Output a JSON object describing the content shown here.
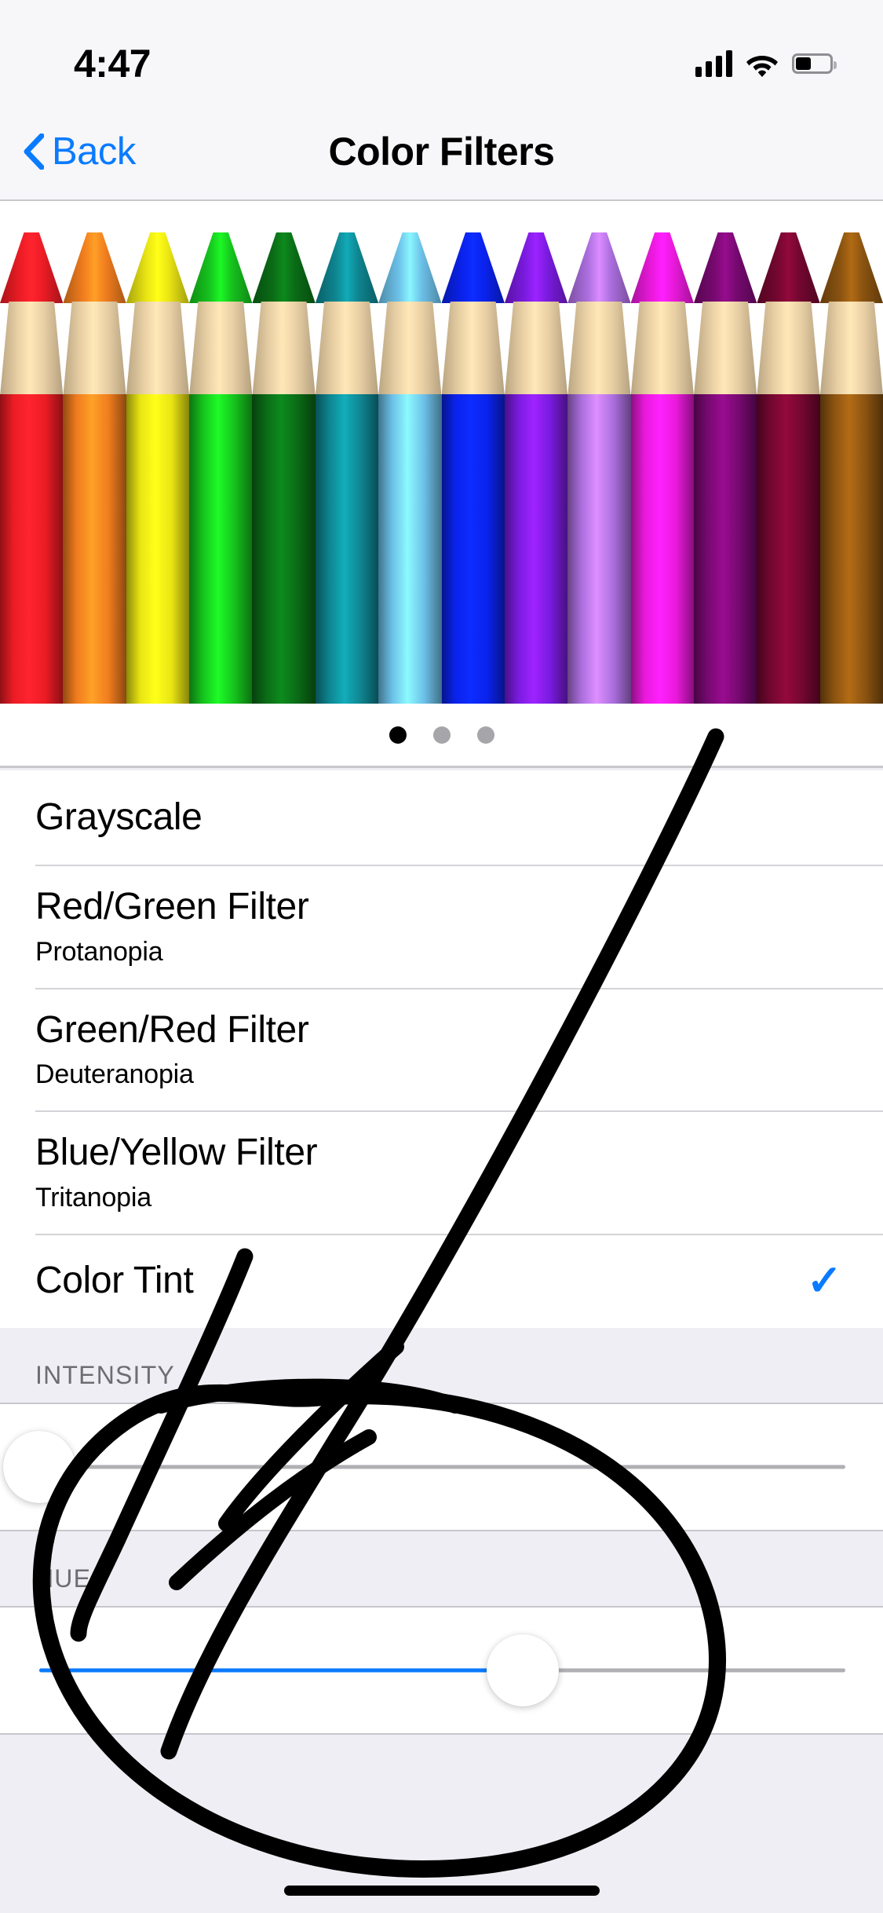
{
  "status_bar": {
    "time": "4:47",
    "signal_icon": "cellular-signal-icon",
    "wifi_icon": "wifi-icon",
    "battery_icon": "battery-icon",
    "battery_level_pct": 45
  },
  "nav_bar": {
    "back_label": "Back",
    "back_icon": "chevron-left-icon",
    "title": "Color Filters"
  },
  "preview": {
    "name": "color-pencils-preview",
    "pencil_colors": [
      "#ec1c24",
      "#f07c1e",
      "#e9e413",
      "#16c21d",
      "#0a6b16",
      "#0e8590",
      "#6cc0e8",
      "#0a22ec",
      "#7a1bdf",
      "#ab6ede",
      "#e919da",
      "#76096f",
      "#72072f",
      "#8a5310"
    ],
    "wood_color": "#e8cfa4",
    "page_dots": {
      "count": 3,
      "active_index": 0
    }
  },
  "filters": {
    "rows": [
      {
        "title": "Grayscale",
        "subtitle": "",
        "selected": false
      },
      {
        "title": "Red/Green Filter",
        "subtitle": "Protanopia",
        "selected": false
      },
      {
        "title": "Green/Red Filter",
        "subtitle": "Deuteranopia",
        "selected": false
      },
      {
        "title": "Blue/Yellow Filter",
        "subtitle": "Tritanopia",
        "selected": false
      },
      {
        "title": "Color Tint",
        "subtitle": "",
        "selected": true
      }
    ],
    "check_glyph": "✓"
  },
  "intensity": {
    "header": "INTENSITY",
    "slider_name": "intensity-slider",
    "value_pct": 0
  },
  "hue": {
    "header": "HUE",
    "slider_name": "hue-slider",
    "value_pct": 60
  },
  "annotation": {
    "name": "handwritten-ink-annotation",
    "color": "#000000",
    "shapes": [
      "arrow-stroke",
      "circle-stroke",
      "scribble-stroke"
    ]
  },
  "colors": {
    "accent_blue": "#0a7bff",
    "group_background": "#efeef4",
    "cell_background": "#ffffff",
    "separator": "#c8c7cc",
    "header_text": "#6d6d72",
    "chrome_background": "#f7f7f9"
  },
  "home_indicator": {
    "name": "home-indicator"
  }
}
